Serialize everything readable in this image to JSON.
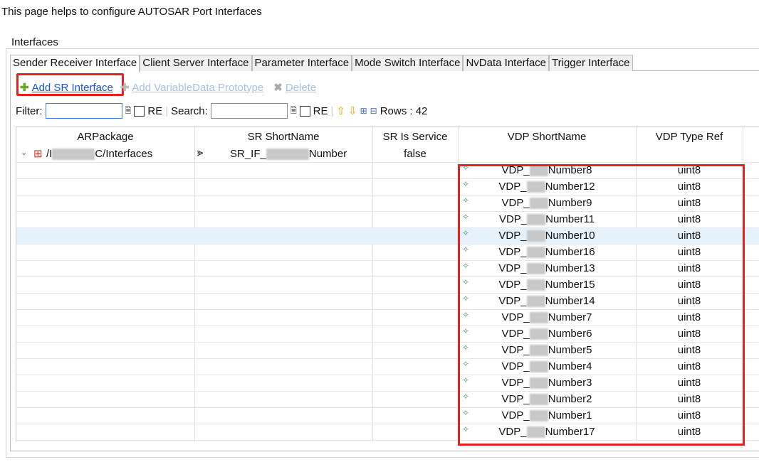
{
  "intro": "This page helps to configure AUTOSAR Port Interfaces",
  "group_label": "Interfaces",
  "tabs": [
    "Sender Receiver Interface",
    "Client Server Interface",
    "Parameter Interface",
    "Mode Switch Interface",
    "NvData Interface",
    "Trigger Interface"
  ],
  "toolbar": {
    "add_sr": "Add SR Interface",
    "add_vdp": "Add VariableData Prototype",
    "delete": "Delete"
  },
  "filter": {
    "filter_label": "Filter:",
    "re": "RE",
    "search_label": "Search:",
    "rows": "Rows : 42"
  },
  "columns": [
    "ARPackage",
    "SR ShortName",
    "SR Is Service",
    "VDP ShortName",
    "VDP Type Ref"
  ],
  "parent": {
    "package_prefix": "/I",
    "package_suffix": "C/Interfaces",
    "short_prefix": "SR_IF_",
    "short_suffix": "Number",
    "is_service": "false"
  },
  "rows": [
    {
      "prefix": "VDP_",
      "suffix": "Number8",
      "type": "uint8"
    },
    {
      "prefix": "VDP_",
      "suffix": "Number12",
      "type": "uint8"
    },
    {
      "prefix": "VDP_",
      "suffix": "Number9",
      "type": "uint8"
    },
    {
      "prefix": "VDP_",
      "suffix": "Number11",
      "type": "uint8"
    },
    {
      "prefix": "VDP_",
      "suffix": "Number10",
      "type": "uint8"
    },
    {
      "prefix": "VDP_",
      "suffix": "Number16",
      "type": "uint8"
    },
    {
      "prefix": "VDP_",
      "suffix": "Number13",
      "type": "uint8"
    },
    {
      "prefix": "VDP_",
      "suffix": "Number15",
      "type": "uint8"
    },
    {
      "prefix": "VDP_",
      "suffix": "Number14",
      "type": "uint8"
    },
    {
      "prefix": "VDP_",
      "suffix": "Number7",
      "type": "uint8"
    },
    {
      "prefix": "VDP_",
      "suffix": "Number6",
      "type": "uint8"
    },
    {
      "prefix": "VDP_",
      "suffix": "Number5",
      "type": "uint8"
    },
    {
      "prefix": "VDP_",
      "suffix": "Number4",
      "type": "uint8"
    },
    {
      "prefix": "VDP_",
      "suffix": "Number3",
      "type": "uint8"
    },
    {
      "prefix": "VDP_",
      "suffix": "Number2",
      "type": "uint8"
    },
    {
      "prefix": "VDP_",
      "suffix": "Number1",
      "type": "uint8"
    },
    {
      "prefix": "VDP_",
      "suffix": "Number17",
      "type": "uint8"
    }
  ]
}
